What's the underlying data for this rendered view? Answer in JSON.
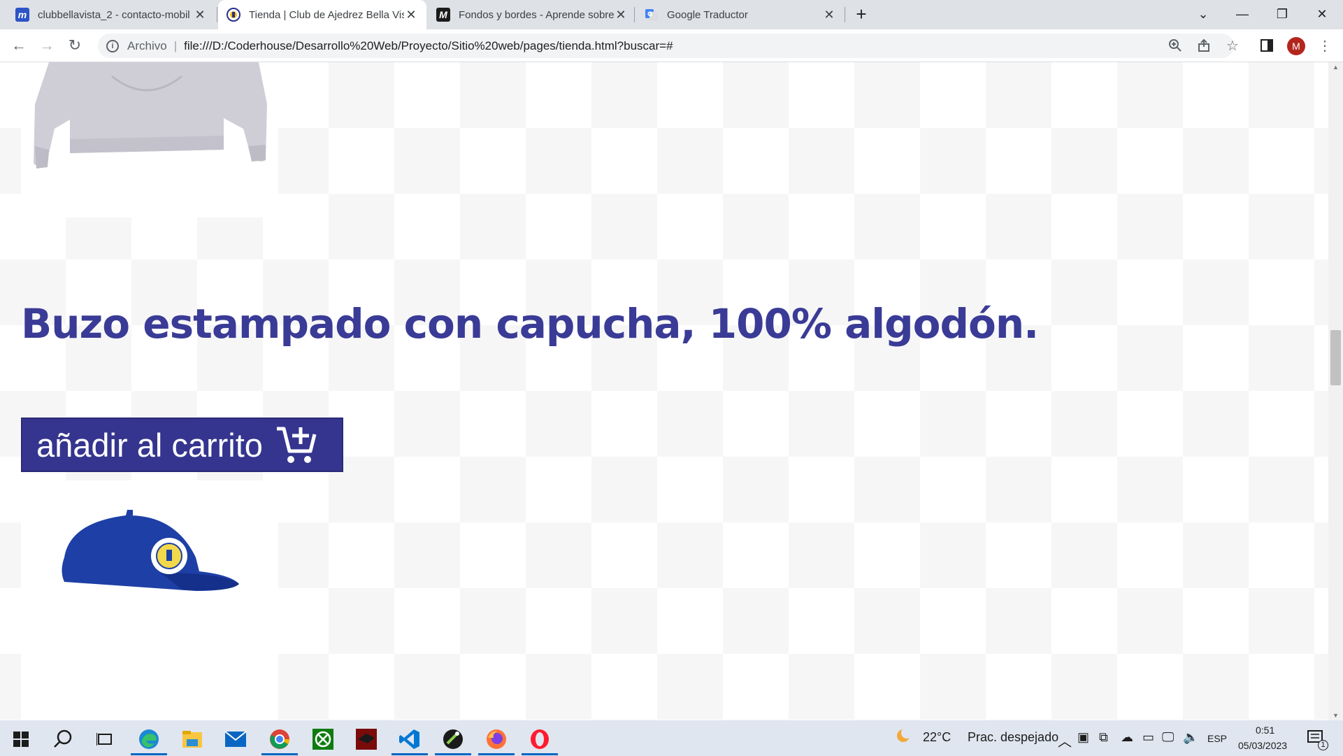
{
  "browser": {
    "tabs": [
      {
        "title": "clubbellavista_2 - contacto-mobil",
        "favicon": "m-icon",
        "active": false
      },
      {
        "title": "Tienda | Club de Ajedrez Bella Vis",
        "favicon": "club-logo-icon",
        "active": true
      },
      {
        "title": "Fondos y bordes - Aprende sobre",
        "favicon": "mdn-m-icon",
        "active": false
      },
      {
        "title": "Google Traductor",
        "favicon": "google-translate-icon",
        "active": false
      }
    ],
    "omnibox": {
      "scheme_label": "Archivo",
      "separator": "|",
      "url": "file:///D:/Coderhouse/Desarrollo%20Web/Proyecto/Sitio%20web/pages/tienda.html?buscar=#"
    },
    "profile_initial": "M"
  },
  "page": {
    "product_title": "Buzo estampado con capucha, 100% algodón.",
    "add_to_cart_label": "añadir al carrito",
    "background_pattern_color": "#f6f6f6",
    "accent_color": "#3a3b96",
    "button_color": "#35358f"
  },
  "taskbar": {
    "weather_temp": "22°C",
    "weather_text": "Prac. despejado",
    "language": "ESP",
    "time": "0:51",
    "date": "05/03/2023",
    "notification_count": "1"
  }
}
